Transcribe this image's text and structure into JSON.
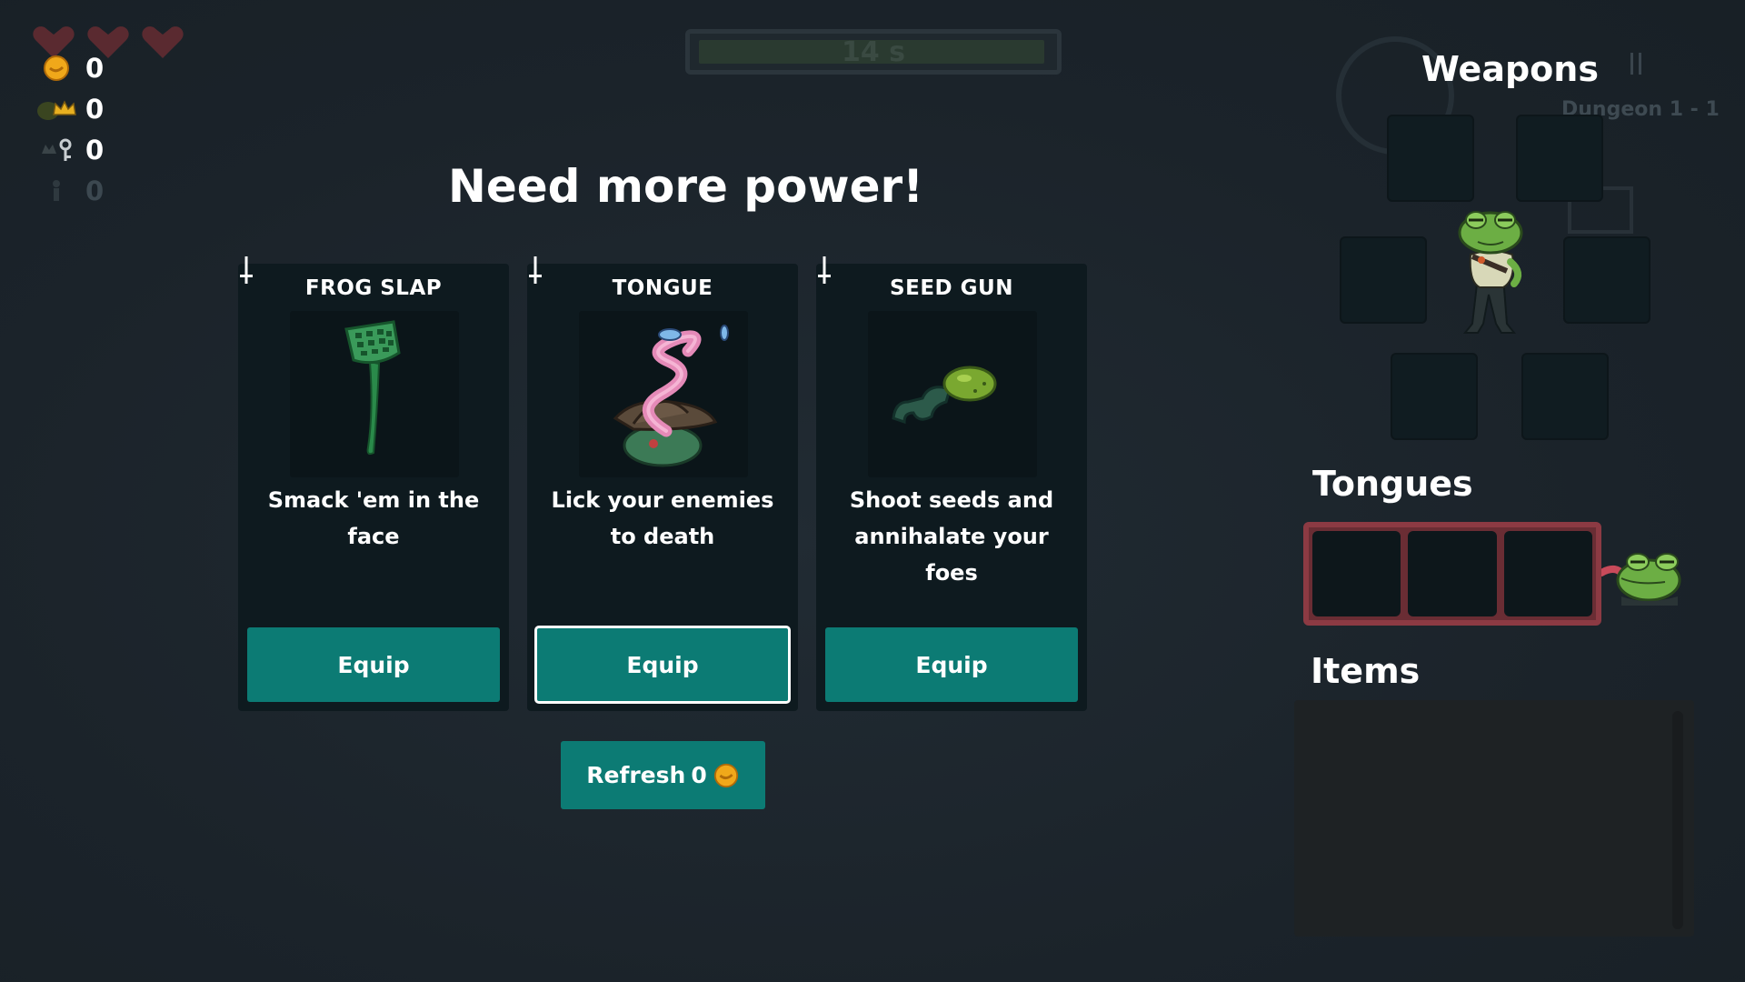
{
  "hud": {
    "hearts": 3,
    "coins": "0",
    "crowns": "0",
    "keys": "0",
    "extra": "0"
  },
  "timer": {
    "label": "14 s"
  },
  "dungeon_label": "Dungeon 1 - 1",
  "title": "Need more power!",
  "cards": [
    {
      "name": "FROG SLAP",
      "description": "Smack 'em in the face",
      "button": "Equip",
      "icon": "fly-swatter-icon"
    },
    {
      "name": "TONGUE",
      "description": "Lick your enemies to death",
      "button": "Equip",
      "icon": "tongue-frog-icon"
    },
    {
      "name": "SEED GUN",
      "description": "Shoot seeds and annihalate your foes",
      "button": "Equip",
      "icon": "seed-gun-icon"
    }
  ],
  "refresh": {
    "label": "Refresh",
    "cost": "0"
  },
  "panel": {
    "weapons_title": "Weapons",
    "tongues_title": "Tongues",
    "items_title": "Items"
  },
  "colors": {
    "background": "#1d262d",
    "card": "#0e1a1f",
    "button": "#0c7b74",
    "tongue_frame": "#8c3a43",
    "heart": "#5a2a30",
    "coin": "#f0a81a"
  }
}
